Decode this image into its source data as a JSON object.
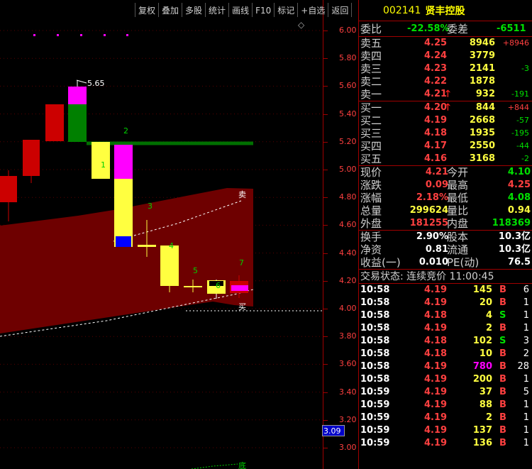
{
  "toolbar": [
    "复权",
    "叠加",
    "多股",
    "统计",
    "画线",
    "F10",
    "标记",
    "+自选",
    "返回"
  ],
  "chart": {
    "price_ticks": [
      "6.00",
      "5.80",
      "5.60",
      "5.40",
      "5.20",
      "5.00",
      "4.80",
      "4.60",
      "4.40",
      "4.20",
      "4.00",
      "3.80",
      "3.60",
      "3.40",
      "3.20",
      "3.00"
    ],
    "current_price_label": "3.09",
    "high_annotation": "5.65",
    "sell_label": "卖",
    "buy_label": "买",
    "bottom_label": "底",
    "numbers": [
      "1",
      "2",
      "3",
      "4",
      "5",
      "6",
      "7"
    ],
    "diamond": "◇"
  },
  "stock": {
    "code": "002141",
    "name": "贤丰控股"
  },
  "ratio": {
    "label1": "委比",
    "value1": "-22.58%",
    "label2": "委差",
    "value2": "-6511"
  },
  "asks": [
    {
      "label": "卖五",
      "price": "4.25",
      "vol": "8946",
      "chg": "+8946",
      "arrow": ""
    },
    {
      "label": "卖四",
      "price": "4.24",
      "vol": "3779",
      "chg": "",
      "arrow": ""
    },
    {
      "label": "卖三",
      "price": "4.23",
      "vol": "2141",
      "chg": "-3",
      "arrow": ""
    },
    {
      "label": "卖二",
      "price": "4.22",
      "vol": "1878",
      "chg": "",
      "arrow": ""
    },
    {
      "label": "卖一",
      "price": "4.21",
      "vol": "932",
      "chg": "-191",
      "arrow": "🡑"
    }
  ],
  "bids": [
    {
      "label": "买一",
      "price": "4.20",
      "vol": "844",
      "chg": "+844",
      "arrow": "🡑"
    },
    {
      "label": "买二",
      "price": "4.19",
      "vol": "2668",
      "chg": "-57",
      "arrow": ""
    },
    {
      "label": "买三",
      "price": "4.18",
      "vol": "1935",
      "chg": "-195",
      "arrow": ""
    },
    {
      "label": "买四",
      "price": "4.17",
      "vol": "2550",
      "chg": "-44",
      "arrow": ""
    },
    {
      "label": "买五",
      "price": "4.16",
      "vol": "3168",
      "chg": "-2",
      "arrow": ""
    }
  ],
  "quote": [
    {
      "l1": "现价",
      "v1": "4.21",
      "l2": "今开",
      "v2": "4.10"
    },
    {
      "l1": "涨跌",
      "v1": "0.09",
      "l2": "最高",
      "v2": "4.25"
    },
    {
      "l1": "涨幅",
      "v1": "2.18%",
      "l2": "最低",
      "v2": "4.08"
    },
    {
      "l1": "总量",
      "v1": "299624",
      "l2": "量比",
      "v2": "0.94"
    },
    {
      "l1": "外盘",
      "v1": "181255",
      "l2": "内盘",
      "v2": "118369"
    }
  ],
  "fund": [
    {
      "l1": "换手",
      "v1": "2.90%",
      "l2": "股本",
      "v2": "10.3亿"
    },
    {
      "l1": "净资",
      "v1": "0.81",
      "l2": "流通",
      "v2": "10.3亿"
    },
    {
      "l1": "收益(一)",
      "v1": "0.010",
      "l2": "PE(动)",
      "v2": "76.5"
    }
  ],
  "trade_status": "交易状态: 连续竞价 11:00:45",
  "ticks": [
    {
      "time": "10:58",
      "price": "4.19",
      "vol": "145",
      "flag": "B",
      "n": "6"
    },
    {
      "time": "10:58",
      "price": "4.19",
      "vol": "20",
      "flag": "B",
      "n": "1"
    },
    {
      "time": "10:58",
      "price": "4.18",
      "vol": "4",
      "flag": "S",
      "n": "1"
    },
    {
      "time": "10:58",
      "price": "4.19",
      "vol": "2",
      "flag": "B",
      "n": "1"
    },
    {
      "time": "10:58",
      "price": "4.18",
      "vol": "102",
      "flag": "S",
      "n": "3"
    },
    {
      "time": "10:58",
      "price": "4.18",
      "vol": "10",
      "flag": "B",
      "n": "2"
    },
    {
      "time": "10:58",
      "price": "4.19",
      "vol": "780",
      "flag": "B",
      "n": "28"
    },
    {
      "time": "10:58",
      "price": "4.19",
      "vol": "200",
      "flag": "B",
      "n": "1"
    },
    {
      "time": "10:59",
      "price": "4.19",
      "vol": "37",
      "flag": "B",
      "n": "5"
    },
    {
      "time": "10:59",
      "price": "4.19",
      "vol": "88",
      "flag": "B",
      "n": "1"
    },
    {
      "time": "10:59",
      "price": "4.19",
      "vol": "2",
      "flag": "B",
      "n": "1"
    },
    {
      "time": "10:59",
      "price": "4.19",
      "vol": "137",
      "flag": "B",
      "n": "1"
    },
    {
      "time": "10:59",
      "price": "4.19",
      "vol": "136",
      "flag": "B",
      "n": "1"
    }
  ],
  "colors": {
    "up": "#ff4040",
    "down": "#00e000",
    "accent_yellow": "#ffff00",
    "border": "#a00000"
  }
}
